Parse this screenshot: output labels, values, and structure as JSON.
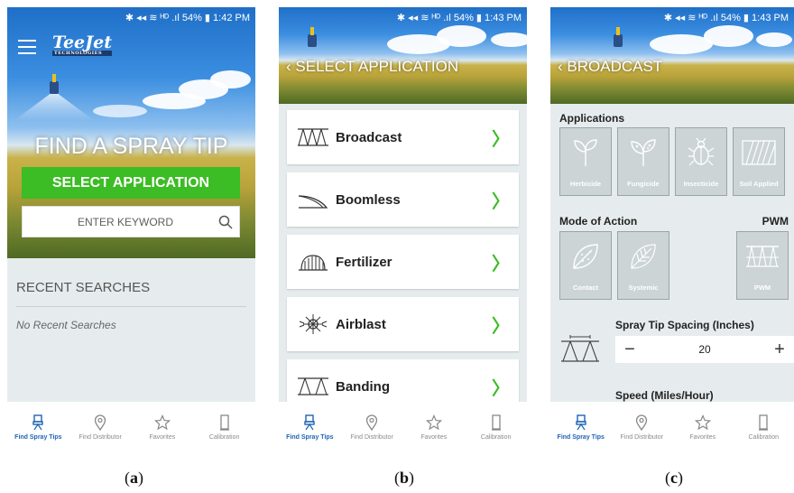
{
  "status_bar": {
    "a": "✱ ◂◂ ≋ ᴴᴰ .ıl 54% ▮ 1:42 PM",
    "b": "✱ ◂◂ ≋ ᴴᴰ .ıl 54% ▮ 1:43 PM",
    "c": "✱ ◂◂ ≋ ᴴᴰ .ıl 54% ▮ 1:43 PM"
  },
  "panel_a": {
    "logo": "TeeJet",
    "logo_sub": "TECHNOLOGIES",
    "title": "FIND A SPRAY TIP",
    "select_button": "SELECT APPLICATION",
    "search_placeholder": "ENTER KEYWORD",
    "recent_heading": "RECENT SEARCHES",
    "recent_empty": "No Recent Searches",
    "caption_letter": "a"
  },
  "panel_b": {
    "title": "SELECT APPLICATION",
    "items": [
      {
        "label": "Broadcast",
        "icon": "broadcast-icon"
      },
      {
        "label": "Boomless",
        "icon": "boomless-icon"
      },
      {
        "label": "Fertilizer",
        "icon": "fertilizer-icon"
      },
      {
        "label": "Airblast",
        "icon": "airblast-icon"
      },
      {
        "label": "Banding",
        "icon": "banding-icon"
      }
    ],
    "caption_letter": "b"
  },
  "panel_c": {
    "title": "BROADCAST",
    "applications_heading": "Applications",
    "applications": [
      "Herbicide",
      "Fungicide",
      "Insecticide",
      "Soil Applied"
    ],
    "mode_heading": "Mode of Action",
    "pwm_heading": "PWM",
    "modes": [
      "Contact",
      "Systemic"
    ],
    "pwm_tile": "PWM",
    "spacing_label": "Spray Tip Spacing (Inches)",
    "spacing_value": "20",
    "minus": "−",
    "plus": "+",
    "speed_label": "Speed (Miles/Hour)",
    "caption_letter": "c"
  },
  "bottom_nav": [
    "Find Spray Tips",
    "Find Distributor",
    "Favorites",
    "Calibration"
  ],
  "colors": {
    "accent_green": "#3cbc25",
    "nav_active": "#1e64b4",
    "background": "#e6eced"
  }
}
